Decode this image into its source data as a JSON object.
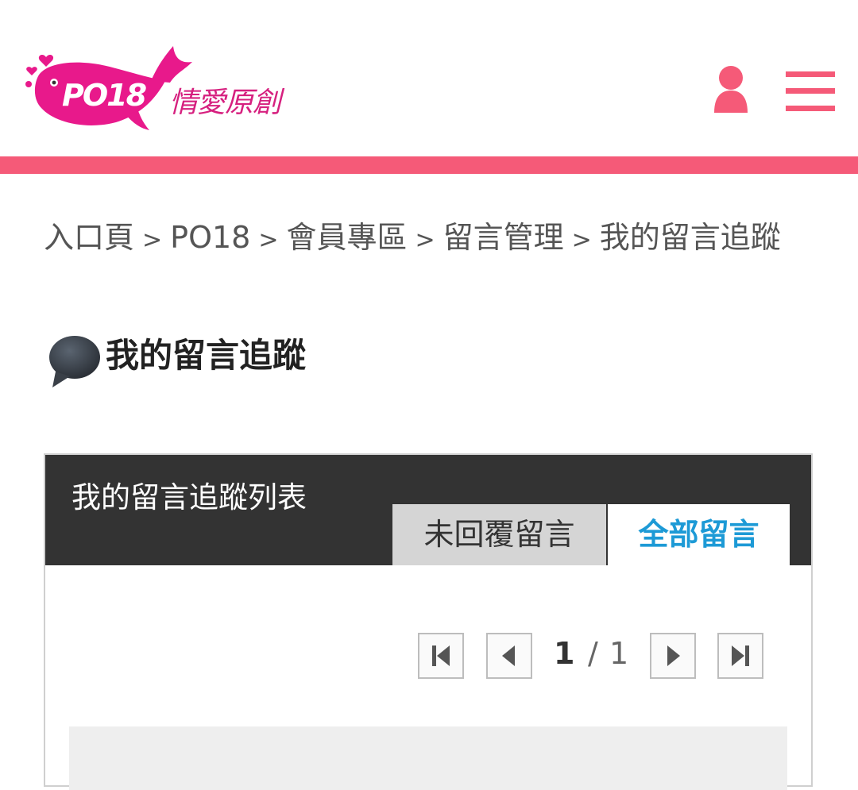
{
  "header": {
    "logo_text": "PO18",
    "brand_text": "情愛原創",
    "user_icon": "user-icon",
    "menu_icon": "hamburger-menu-icon",
    "accent_color": "#f55a78",
    "logo_color": "#e8198b"
  },
  "breadcrumb": {
    "items": [
      "入口頁",
      "PO18",
      "會員專區",
      "留言管理",
      "我的留言追蹤"
    ],
    "separator": ">"
  },
  "page": {
    "title": "我的留言追蹤",
    "title_icon": "speech-bubble-icon"
  },
  "panel": {
    "title": "我的留言追蹤列表",
    "tabs": [
      {
        "label": "未回覆留言",
        "active": false
      },
      {
        "label": "全部留言",
        "active": true
      }
    ],
    "active_tab_color": "#1d9ad6"
  },
  "pagination": {
    "current": "1",
    "separator": "/",
    "total": "1"
  }
}
